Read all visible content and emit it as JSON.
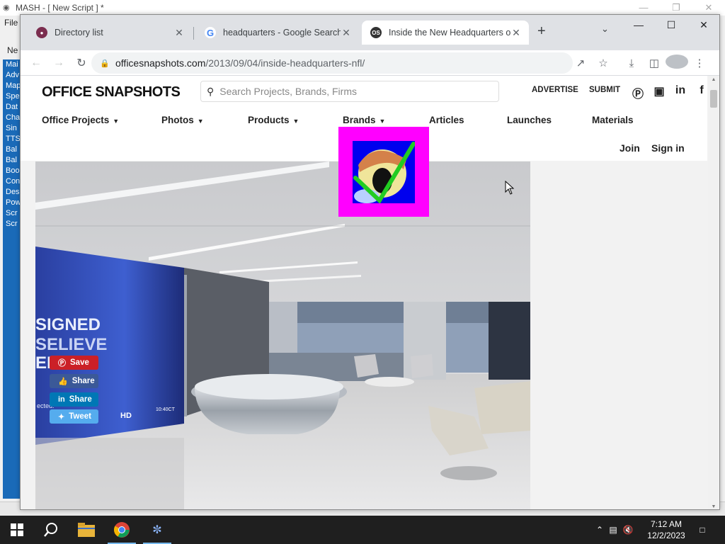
{
  "background_app": {
    "title": "MASH - [ New Script ] *",
    "menu_file": "File",
    "new_label": "Ne",
    "side_items": [
      "Mai",
      "Adv",
      "Map",
      "Spe",
      "Dat",
      "Cha",
      "Sin",
      "TTS",
      "Bal",
      "Bal",
      "Boo",
      "Con",
      "Des",
      "Pow",
      "Scr",
      "Scr"
    ]
  },
  "browser": {
    "tabs": [
      {
        "title": "Directory list",
        "favicon": "directory-favicon",
        "active": false
      },
      {
        "title": "headquarters - Google Search",
        "favicon": "google-favicon",
        "active": false
      },
      {
        "title": "Inside the New Headquarters o",
        "favicon": "os-favicon",
        "active": true
      }
    ],
    "new_tab_label": "+",
    "url_host": "officesnapshots.com",
    "url_path": "/2013/09/04/inside-headquarters-nfl/",
    "active_favicon_text": "OS"
  },
  "site": {
    "logo": "OFFICE SNAPSHOTS",
    "search_placeholder": "Search Projects, Brands, Firms",
    "advertise": "ADVERTISE",
    "submit": "SUBMIT",
    "nav": [
      "Office Projects",
      "Photos",
      "Products",
      "Brands",
      "Articles",
      "Launches",
      "Materials"
    ],
    "join": "Join",
    "sign_in": "Sign in",
    "share_buttons": [
      {
        "label": "Save",
        "color": "#cb2027"
      },
      {
        "label": "Share",
        "color": "#3b5998"
      },
      {
        "label": "Share",
        "color": "#0077b5"
      },
      {
        "label": "Tweet",
        "color": "#55acee"
      }
    ],
    "hero_wall_text": [
      "SIGNED",
      "SELIEVE",
      "ERTS"
    ],
    "hero_small_text": "ected.",
    "hero_tv": "HD",
    "hero_time": "10:40CT"
  },
  "taskbar": {
    "time": "7:12 AM",
    "date": "12/2/2023"
  },
  "colors": {
    "magenta_badge": "#ff00ff",
    "badge_inner": "#0000ee",
    "check": "#22cc22"
  }
}
